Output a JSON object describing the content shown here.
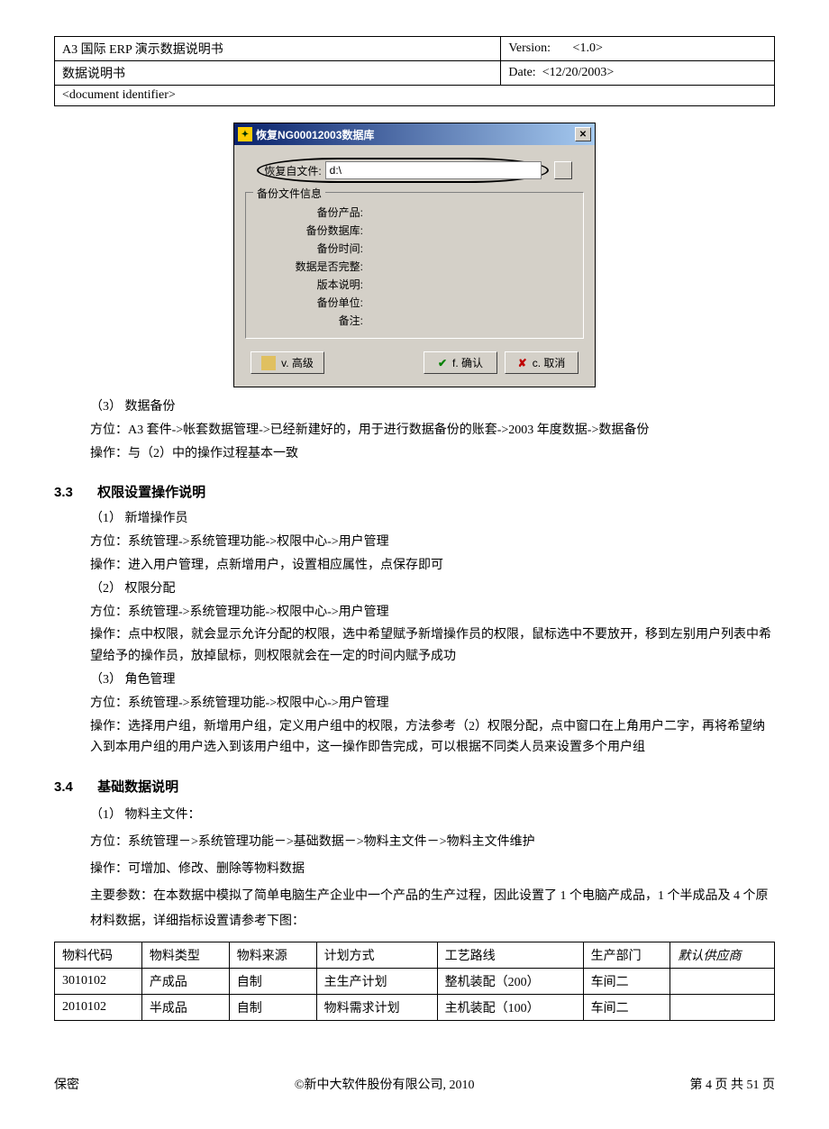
{
  "header": {
    "r1c1": "A3 国际 ERP 演示数据说明书",
    "r1c2a": "Version:",
    "r1c2b": "<1.0>",
    "r2c1": "数据说明书",
    "r2c2a": "Date:",
    "r2c2b": "<12/20/2003>",
    "r3": "<document identifier>"
  },
  "dialog": {
    "title": "恢复NG00012003数据库",
    "fileLabel": "恢复自文件:",
    "fileValue": "d:\\",
    "groupTitle": "备份文件信息",
    "rows": [
      "备份产品:",
      "备份数据库:",
      "备份时间:",
      "数据是否完整:",
      "版本说明:",
      "备份单位:",
      "备注:"
    ],
    "btnAdvanced": "v. 高级",
    "btnOk": "f. 确认",
    "btnCancel": "c. 取消"
  },
  "sec32": {
    "item3": "（3）   数据备份",
    "p1": "方位：A3 套件->帐套数据管理->已经新建好的，用于进行数据备份的账套->2003 年度数据->数据备份",
    "p2": "操作：与（2）中的操作过程基本一致"
  },
  "sec33": {
    "num": "3.3",
    "title": "权限设置操作说明",
    "item1": "（1）   新增操作员",
    "p1a": "方位：系统管理->系统管理功能->权限中心->用户管理",
    "p1b": "操作：进入用户管理，点新增用户，设置相应属性，点保存即可",
    "item2": "（2）   权限分配",
    "p2a": "方位：系统管理->系统管理功能->权限中心->用户管理",
    "p2b": "操作：点中权限，就会显示允许分配的权限，选中希望赋予新增操作员的权限，鼠标选中不要放开，移到左别用户列表中希望给予的操作员，放掉鼠标，则权限就会在一定的时间内赋予成功",
    "item3": "（3）   角色管理",
    "p3a": "方位：系统管理->系统管理功能->权限中心->用户管理",
    "p3b": "操作：选择用户组，新增用户组，定义用户组中的权限，方法参考（2）权限分配，点中窗口在上角用户二字，再将希望纳入到本用户组的用户选入到该用户组中，这一操作即告完成，可以根据不同类人员来设置多个用户组"
  },
  "sec34": {
    "num": "3.4",
    "title": "基础数据说明",
    "item1": "（1）   物料主文件：",
    "p1": "方位：系统管理－>系统管理功能－>基础数据－>物料主文件－>物料主文件维护",
    "p2": "操作：可增加、修改、删除等物料数据",
    "p3": "主要参数：在本数据中模拟了简单电脑生产企业中一个产品的生产过程，因此设置了 1 个电脑产成品，1 个半成品及 4 个原材料数据，详细指标设置请参考下图："
  },
  "table": {
    "headers": [
      "物料代码",
      "物料类型",
      "物料来源",
      "计划方式",
      "工艺路线",
      "生产部门",
      "默认供应商"
    ],
    "rows": [
      [
        "3010102",
        "产成品",
        "自制",
        "主生产计划",
        "整机装配（200）",
        "车间二",
        ""
      ],
      [
        "2010102",
        "半成品",
        "自制",
        "物料需求计划",
        "主机装配（100）",
        "车间二",
        ""
      ]
    ]
  },
  "footer": {
    "left": "保密",
    "center": "©新中大软件股份有限公司, 2010",
    "right": "第 4 页 共 51 页"
  }
}
